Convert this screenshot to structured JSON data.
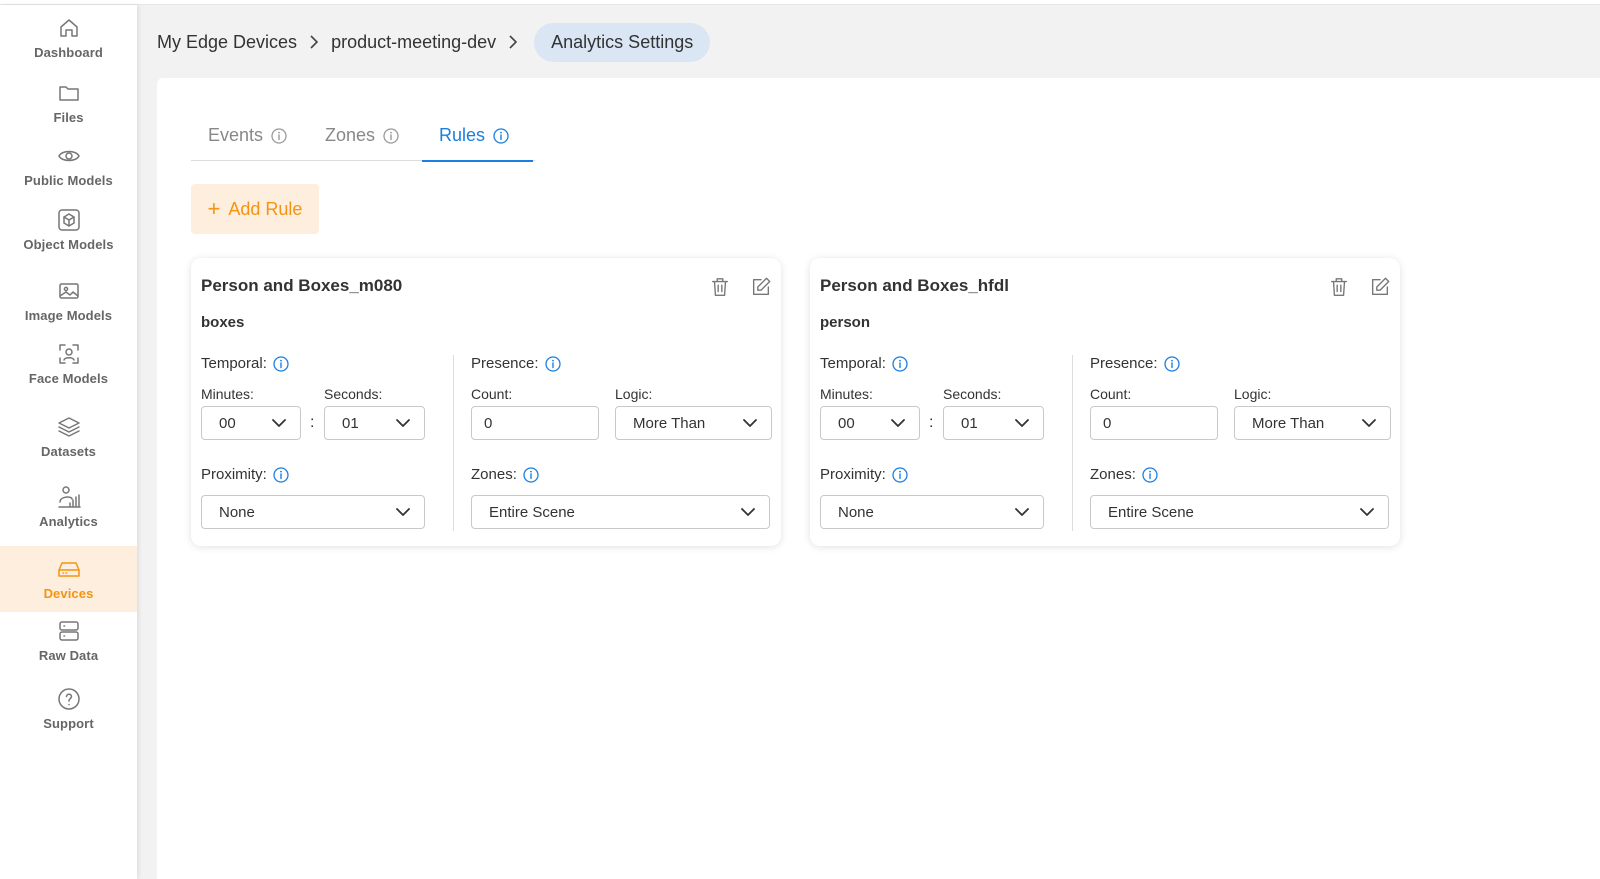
{
  "sidebar": {
    "items": [
      {
        "label": "Dashboard",
        "icon": "home-icon"
      },
      {
        "label": "Files",
        "icon": "folder-icon"
      },
      {
        "label": "Public Models",
        "icon": "eye-icon"
      },
      {
        "label": "Object Models",
        "icon": "cube-icon"
      },
      {
        "label": "Image Models",
        "icon": "image-icon"
      },
      {
        "label": "Face Models",
        "icon": "face-scan-icon"
      },
      {
        "label": "Datasets",
        "icon": "layers-icon"
      },
      {
        "label": "Analytics",
        "icon": "analytics-person-icon"
      },
      {
        "label": "Devices",
        "icon": "device-drive-icon",
        "active": true
      },
      {
        "label": "Raw Data",
        "icon": "server-icon"
      },
      {
        "label": "Support",
        "icon": "help-icon"
      }
    ]
  },
  "breadcrumb": {
    "items": [
      "My Edge Devices",
      "product-meeting-dev"
    ],
    "current": "Analytics Settings"
  },
  "tabs": [
    {
      "label": "Events",
      "active": false
    },
    {
      "label": "Zones",
      "active": false
    },
    {
      "label": "Rules",
      "active": true
    }
  ],
  "add_rule_label": "Add Rule",
  "labels": {
    "temporal": "Temporal:",
    "minutes": "Minutes:",
    "seconds": "Seconds:",
    "presence": "Presence:",
    "count": "Count:",
    "logic": "Logic:",
    "proximity": "Proximity:",
    "zones": "Zones:",
    "colon": ":"
  },
  "rules": [
    {
      "title": "Person and Boxes_m080",
      "object": "boxes",
      "minutes": "00",
      "seconds": "01",
      "count": "0",
      "logic": "More Than",
      "proximity": "None",
      "zones": "Entire Scene"
    },
    {
      "title": "Person and Boxes_hfdl",
      "object": "person",
      "minutes": "00",
      "seconds": "01",
      "count": "0",
      "logic": "More Than",
      "proximity": "None",
      "zones": "Entire Scene"
    }
  ],
  "colors": {
    "accent_orange": "#f39414",
    "accent_orange_bg": "#fdeedd",
    "accent_blue": "#1b7fe0",
    "breadcrumb_pill": "#dbe6f5"
  }
}
